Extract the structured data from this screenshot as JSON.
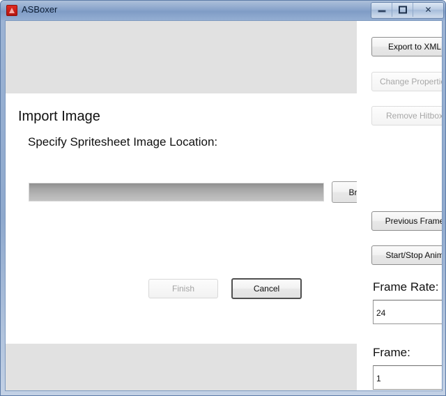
{
  "window": {
    "title": "ASBoxer",
    "icon": "asboxer-app-icon",
    "controls": {
      "minimize": "minimize-icon",
      "maximize": "maximize-icon",
      "close": "✕"
    }
  },
  "main": {
    "heading": "Import Image",
    "subheading": "Specify Spritesheet Image Location:",
    "path_input": {
      "value": "",
      "placeholder": ""
    },
    "browse_label": "Browse...",
    "finish_label": "Finish",
    "cancel_label": "Cancel"
  },
  "sidebar": {
    "buttons": [
      {
        "label": "Export to XML",
        "enabled": true
      },
      {
        "label": "Change Properties",
        "enabled": false
      },
      {
        "label": "Remove Hitbox",
        "enabled": false
      },
      {
        "label": "Previous Frame",
        "enabled": true
      },
      {
        "label": "Start/Stop Anim",
        "enabled": true
      }
    ],
    "frame_rate": {
      "label": "Frame Rate:",
      "value": "24"
    },
    "frame": {
      "label": "Frame:",
      "value": "1"
    }
  }
}
